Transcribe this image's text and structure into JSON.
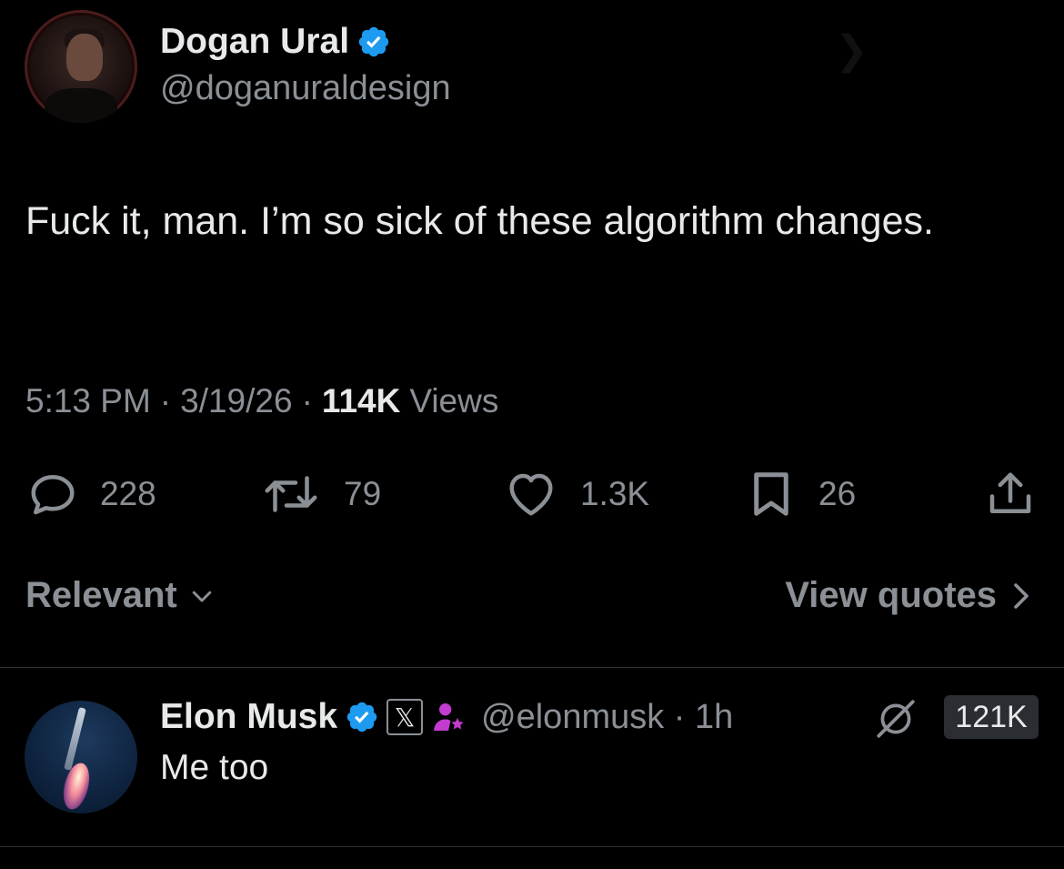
{
  "author": {
    "name": "Dogan Ural",
    "handle": "@doganuraldesign",
    "verified": true
  },
  "tweet": {
    "text": "Fuck it, man. I’m so sick of these algorithm changes.",
    "time": "5:13 PM",
    "sep1": "·",
    "date": "3/19/26",
    "sep2": "·",
    "views_count": "114K",
    "views_label": "Views"
  },
  "actions": {
    "replies": "228",
    "reposts": "79",
    "likes": "1.3K",
    "bookmarks": "26"
  },
  "replies_bar": {
    "sort_label": "Relevant",
    "quotes_label": "View quotes"
  },
  "reply": {
    "name": "Elon Musk",
    "x_badge": "𝕏",
    "handle_time": "@elonmusk · 1h",
    "text": "Me too",
    "view_count": "121K"
  },
  "colors": {
    "background": "#000000",
    "primary_text": "#e7e9ea",
    "secondary_text": "#8b9096",
    "verified_blue": "#1d9bf0",
    "affiliate_purple": "#c13ccf",
    "divider": "#2f3336"
  }
}
